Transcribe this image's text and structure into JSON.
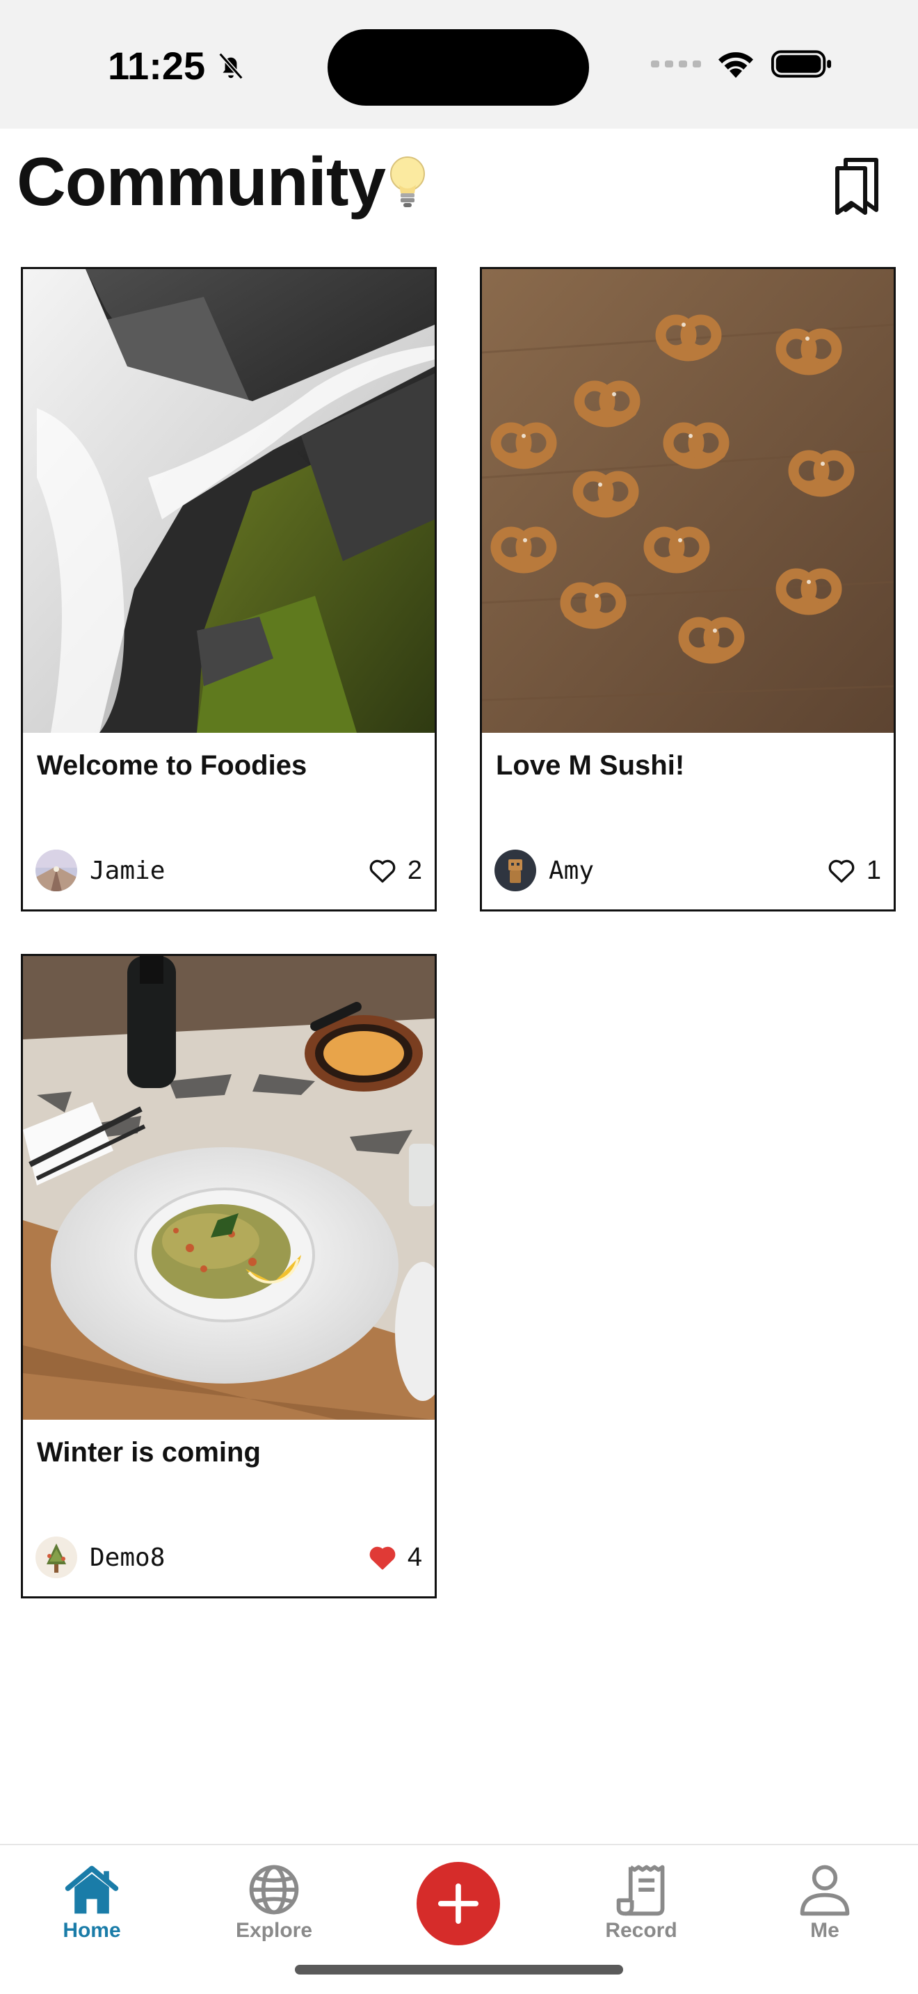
{
  "status_bar": {
    "time": "11:25",
    "icons": [
      "bell-slash-icon",
      "signal-icon",
      "wifi-icon",
      "battery-icon"
    ]
  },
  "header": {
    "title": "Community",
    "title_icon": "lightbulb-icon",
    "action_icon": "bookmarks-icon"
  },
  "posts": [
    {
      "title": "Welcome to Foodies",
      "author": "Jamie",
      "likes": "2",
      "liked": false,
      "image": "waterfall-photo"
    },
    {
      "title": "Love M Sushi!",
      "author": "Amy",
      "likes": "1",
      "liked": false,
      "image": "pretzels-photo"
    },
    {
      "title": "Winter is coming",
      "author": "Demo8",
      "likes": "4",
      "liked": true,
      "image": "food-plate-photo"
    }
  ],
  "tab_bar": {
    "home": "Home",
    "explore": "Explore",
    "add_icon": "plus-icon",
    "record": "Record",
    "me": "Me"
  },
  "colors": {
    "accent_blue": "#1a7ca8",
    "add_red": "#d62c2a",
    "liked_heart": "#e03a36",
    "muted_gray": "#8a8a8a"
  }
}
